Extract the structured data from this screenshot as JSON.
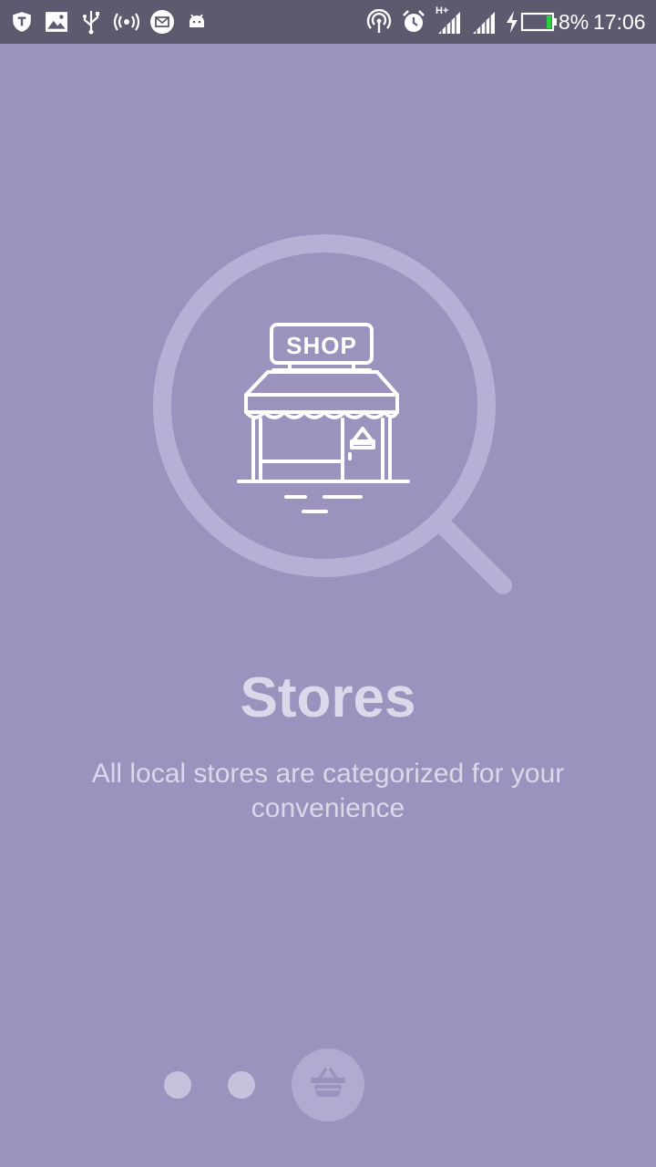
{
  "status_bar": {
    "left_icons": [
      "shield-icon",
      "image-icon",
      "usb-icon",
      "hotspot-icon",
      "mail-icon",
      "android-icon"
    ],
    "right_icons": [
      "wifi-icon",
      "alarm-icon",
      "signal-icon",
      "signal-icon",
      "charging-icon",
      "battery-icon"
    ],
    "network_label": "H+",
    "battery_percent": "8%",
    "battery_level": 0.08,
    "time": "17:06"
  },
  "hero": {
    "sign_text": "SHOP"
  },
  "main": {
    "title": "Stores",
    "subtitle": "All local stores are categorized for your convenience"
  },
  "pager": {
    "page_count": 3,
    "active_index": 2,
    "active_icon": "basket-icon"
  },
  "colors": {
    "background": "#9b92bd",
    "status_bar": "#5d5a70",
    "text": "#dcd8ea",
    "battery_fill": "#2ecc40"
  }
}
